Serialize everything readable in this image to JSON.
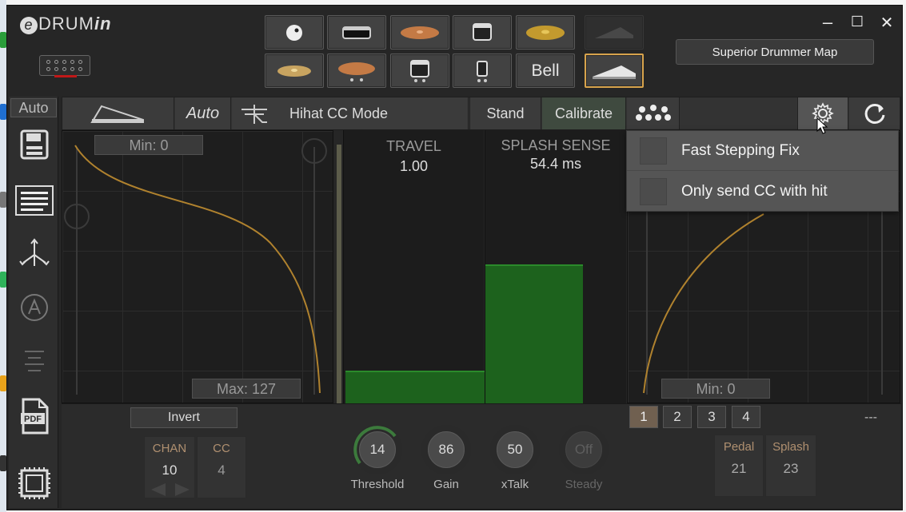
{
  "app": {
    "logo_e": "e",
    "logo_drum": "DRUM",
    "logo_in": "in"
  },
  "pads": {
    "bell_label": "Bell"
  },
  "window": {
    "minimize": "–",
    "maximize": "☐",
    "close": "✕"
  },
  "superior_drummer_map": "Superior Drummer Map",
  "sidebar": {
    "auto_label": "Auto"
  },
  "toolbar": {
    "auto_label": "Auto",
    "mode_label": "Hihat CC Mode",
    "stand_label": "Stand",
    "calibrate_label": "Calibrate"
  },
  "curve_left": {
    "min_label": "Min: 0",
    "max_label": "Max: 127"
  },
  "travel": {
    "title": "TRAVEL",
    "value": "1.00",
    "bar_level": 0.12
  },
  "splash": {
    "title": "SPLASH SENSE",
    "value": "54.4 ms",
    "bar_level": 0.51
  },
  "curve_right": {
    "min_label": "Min: 0"
  },
  "settings_menu": {
    "items": [
      {
        "label": "Fast Stepping Fix"
      },
      {
        "label": "Only send CC with hit"
      }
    ]
  },
  "bottom": {
    "invert_label": "Invert",
    "chan": {
      "label": "CHAN",
      "value": "10"
    },
    "cc": {
      "label": "CC",
      "value": "4"
    },
    "knobs": [
      {
        "value": "14",
        "label": "Threshold"
      },
      {
        "value": "86",
        "label": "Gain"
      },
      {
        "value": "50",
        "label": "xTalk"
      },
      {
        "value": "Off",
        "label": "Steady"
      }
    ],
    "tabs": [
      "1",
      "2",
      "3",
      "4"
    ],
    "dashes": "---",
    "pedal": {
      "label": "Pedal",
      "value": "21"
    },
    "splash": {
      "label": "Splash",
      "value": "23"
    }
  },
  "colors": {
    "accent": "#d7a34c",
    "meter_green": "#1d621d",
    "curve": "#b0822e"
  }
}
